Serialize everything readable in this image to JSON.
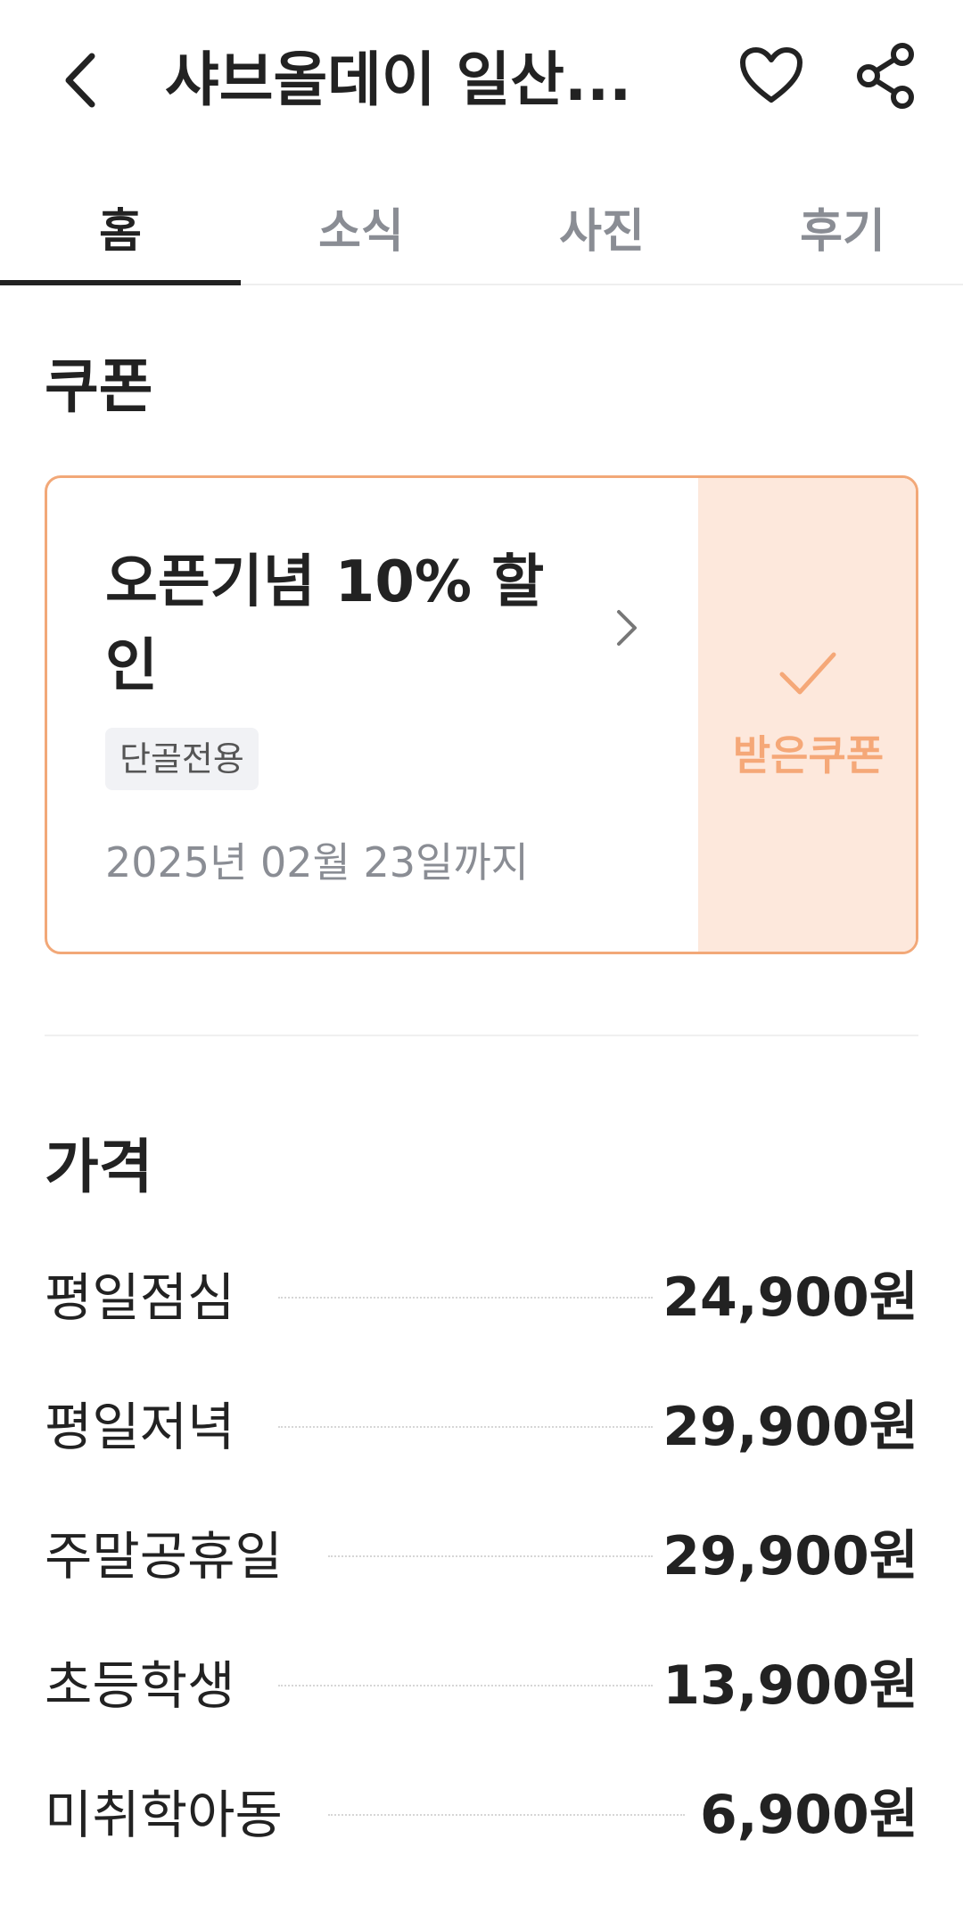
{
  "header": {
    "title": "샤브올데이 일산...",
    "back_icon": "chevron-left-icon",
    "favorite_icon": "heart-icon",
    "share_icon": "share-icon"
  },
  "tabs": [
    {
      "label": "홈",
      "active": true
    },
    {
      "label": "소식",
      "active": false
    },
    {
      "label": "사진",
      "active": false
    },
    {
      "label": "후기",
      "active": false
    }
  ],
  "coupon_section": {
    "title": "쿠폰",
    "coupon": {
      "title": "오픈기념 10% 할인",
      "tag": "단골전용",
      "expiry": "2025년 02월 23일까지",
      "status_label": "받은쿠폰",
      "accent_color": "#F5A878",
      "status_bg_color": "#FDE8DC"
    }
  },
  "price_section": {
    "title": "가격",
    "items": [
      {
        "name": "평일점심",
        "price": "24,900원"
      },
      {
        "name": "평일저녁",
        "price": "29,900원"
      },
      {
        "name": "주말공휴일",
        "price": "29,900원"
      },
      {
        "name": "초등학생",
        "price": "13,900원"
      },
      {
        "name": "미취학아동",
        "price": "6,900원"
      }
    ]
  }
}
